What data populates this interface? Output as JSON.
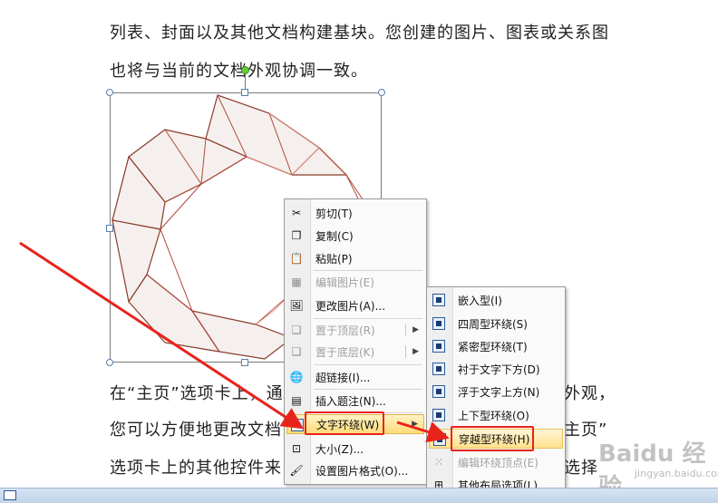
{
  "document": {
    "lines": [
      "列表、封面以及其他文档构建基块。您创建的图片、图表或关系图",
      "也将与当前的文档外观协调一致。",
      "在“主页”选项卡上，通过",
      "您可以方便地更改文档",
      "选项卡上的其他控件来"
    ],
    "right_fragments": [
      "外观，",
      "主页”",
      "选择"
    ]
  },
  "context_menu": {
    "items": [
      {
        "label": "剪切(T)",
        "icon": "scissors-icon",
        "disabled": false
      },
      {
        "label": "复制(C)",
        "icon": "copy-icon",
        "disabled": false
      },
      {
        "label": "粘贴(P)",
        "icon": "paste-icon",
        "disabled": false
      },
      {
        "label": "编辑图片(E)",
        "icon": "edit-picture-icon",
        "disabled": true
      },
      {
        "label": "更改图片(A)...",
        "icon": "change-picture-icon",
        "disabled": false
      },
      {
        "label": "置于顶层(R)",
        "icon": "bring-front-icon",
        "disabled": true
      },
      {
        "label": "置于底层(K)",
        "icon": "send-back-icon",
        "disabled": true
      },
      {
        "label": "超链接(I)...",
        "icon": "hyperlink-icon",
        "disabled": false
      },
      {
        "label": "插入题注(N)...",
        "icon": "caption-icon",
        "disabled": false
      },
      {
        "label": "文字环绕(W)",
        "icon": "text-wrap-icon",
        "disabled": false
      },
      {
        "label": "大小(Z)...",
        "icon": "size-icon",
        "disabled": false
      },
      {
        "label": "设置图片格式(O)...",
        "icon": "format-picture-icon",
        "disabled": false
      }
    ]
  },
  "submenu": {
    "items": [
      {
        "label": "嵌入型(I)",
        "icon": "inline-wrap-icon",
        "disabled": false
      },
      {
        "label": "四周型环绕(S)",
        "icon": "square-wrap-icon",
        "disabled": false
      },
      {
        "label": "紧密型环绕(T)",
        "icon": "tight-wrap-icon",
        "disabled": false
      },
      {
        "label": "衬于文字下方(D)",
        "icon": "behind-text-icon",
        "disabled": false
      },
      {
        "label": "浮于文字上方(N)",
        "icon": "front-text-icon",
        "disabled": false
      },
      {
        "label": "上下型环绕(O)",
        "icon": "top-bottom-wrap-icon",
        "disabled": false
      },
      {
        "label": "穿越型环绕(H)",
        "icon": "through-wrap-icon",
        "disabled": false
      },
      {
        "label": "编辑环绕顶点(E)",
        "icon": "edit-wrap-points-icon",
        "disabled": true
      },
      {
        "label": "其他布局选项(L)...",
        "icon": "more-layout-icon",
        "disabled": false
      }
    ]
  },
  "watermark": {
    "text": "Baidu 经验",
    "sub": "jingyan.baidu.com"
  },
  "colors": {
    "highlight_border": "#e8231b",
    "arrow": "#e8231b",
    "menu_highlight": "#ffdb7a"
  }
}
